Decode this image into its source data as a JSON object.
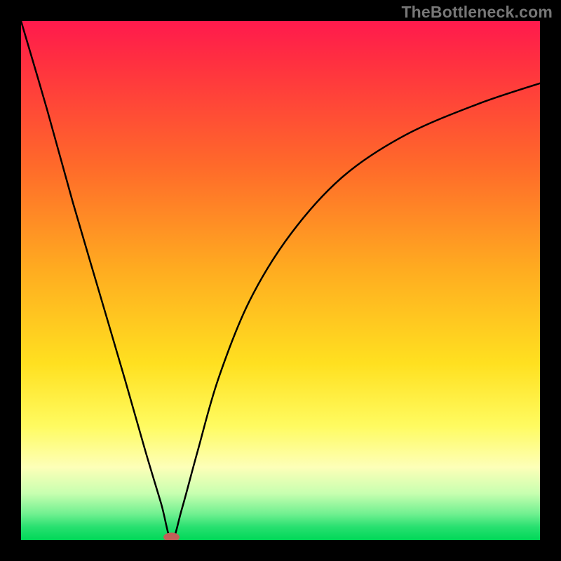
{
  "watermark": "TheBottleneck.com",
  "chart_data": {
    "type": "line",
    "title": "",
    "xlabel": "",
    "ylabel": "",
    "xlim": [
      0,
      100
    ],
    "ylim": [
      0,
      100
    ],
    "grid": false,
    "legend": false,
    "background_gradient": {
      "top_color": "#ff1a4d",
      "bottom_color": "#00d858",
      "meaning_top": "high bottleneck",
      "meaning_bottom": "no bottleneck"
    },
    "minimum_point": {
      "x": 29,
      "y": 0
    },
    "series": [
      {
        "name": "bottleneck-curve",
        "x": [
          0,
          5,
          10,
          15,
          20,
          24,
          27,
          29,
          31,
          34,
          38,
          44,
          52,
          62,
          74,
          88,
          100
        ],
        "y": [
          100,
          83,
          65,
          48,
          31,
          17,
          7,
          0,
          6,
          17,
          31,
          46,
          59,
          70,
          78,
          84,
          88
        ]
      }
    ]
  }
}
